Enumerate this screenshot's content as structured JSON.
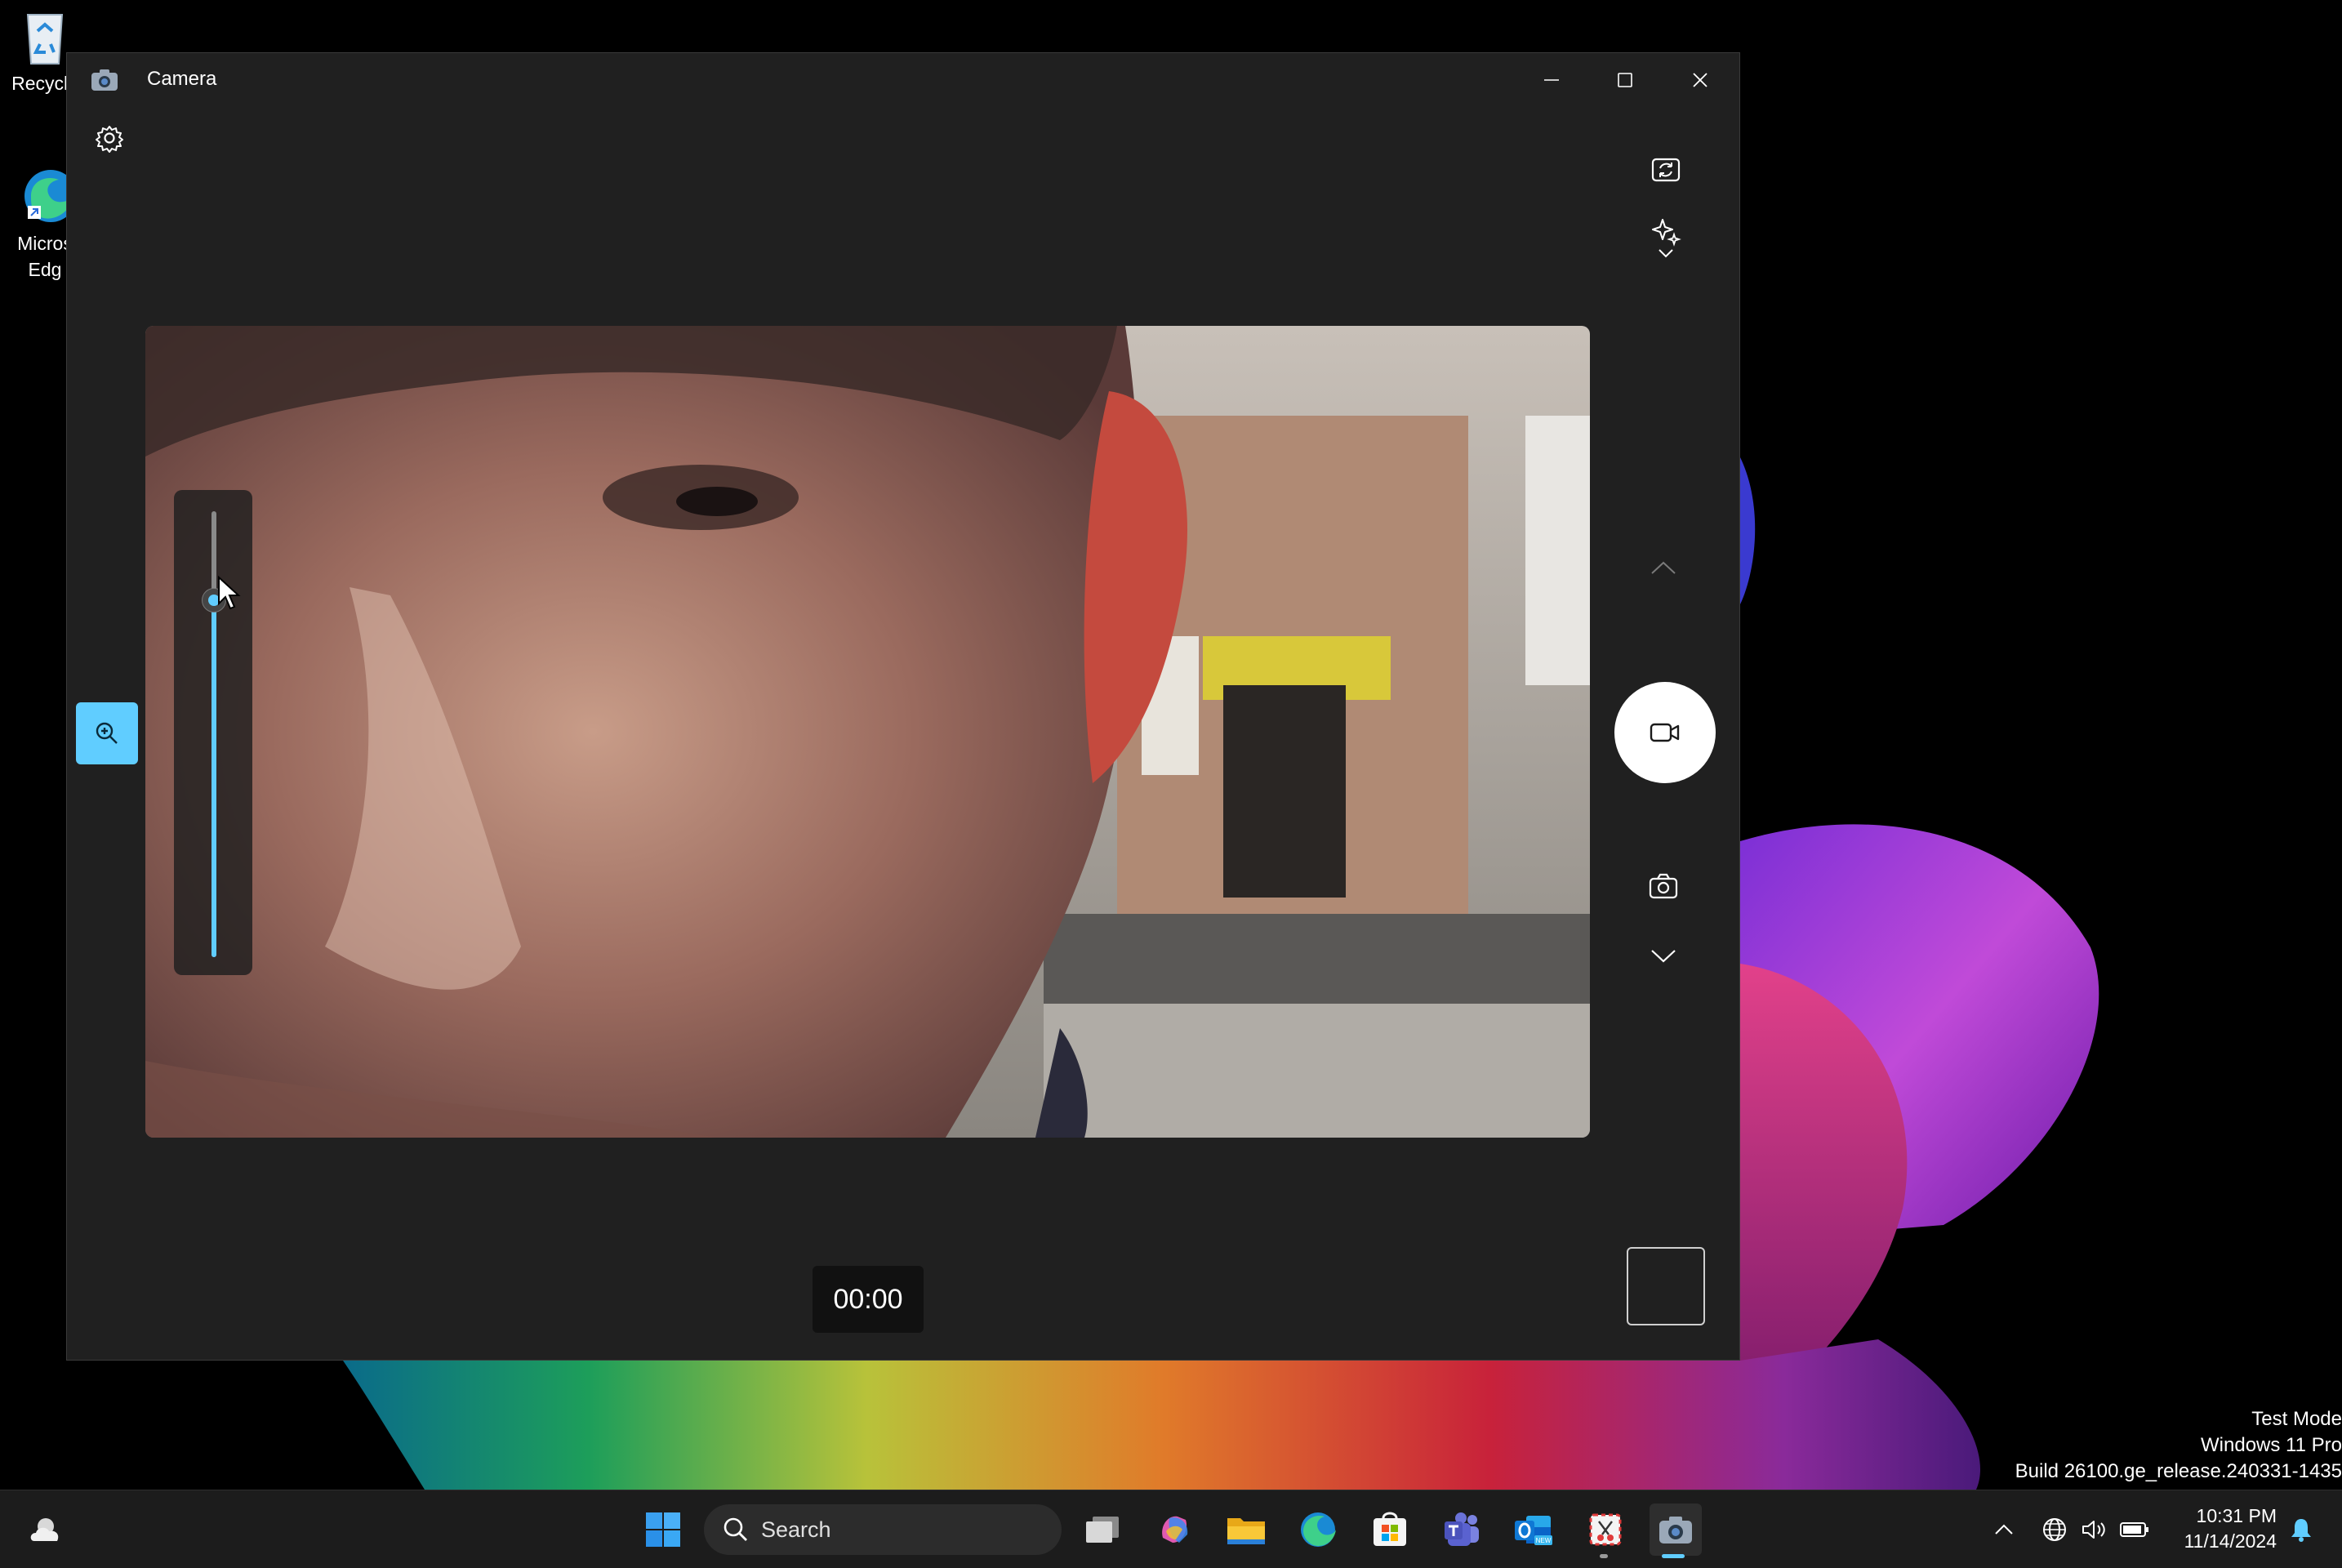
{
  "desktop": {
    "icons": [
      {
        "label": "Recycle",
        "icon": "recycle-bin-icon"
      },
      {
        "label": "Micros\nEdg",
        "icon": "edge-icon"
      }
    ],
    "watermark": {
      "line1": "Test Mode",
      "line2": "Windows 11 Pro",
      "line3": "Build 26100.ge_release.240331-1435"
    }
  },
  "camera": {
    "title": "Camera",
    "buttons": {
      "minimize": "minimize-icon",
      "maximize": "maximize-icon",
      "close": "close-icon",
      "settings": "gear-icon",
      "switch_camera": "switch-camera-icon",
      "effects": "sparkle-icon",
      "zoom": "zoom-in-icon",
      "mode_up": "chevron-up-icon",
      "record": "video-camera-icon",
      "photo": "camera-icon",
      "mode_down": "chevron-down-icon"
    },
    "zoom_level": 0.8,
    "timer": "00:00",
    "accent": "#60cdff"
  },
  "taskbar": {
    "search_label": "Search",
    "apps": [
      "start-icon",
      "task-view-icon",
      "copilot-icon",
      "file-explorer-icon",
      "edge-icon",
      "store-icon",
      "teams-icon",
      "outlook-icon",
      "snipping-tool-icon",
      "camera-icon"
    ],
    "clock": {
      "time": "10:31 PM",
      "date": "11/14/2024"
    }
  }
}
